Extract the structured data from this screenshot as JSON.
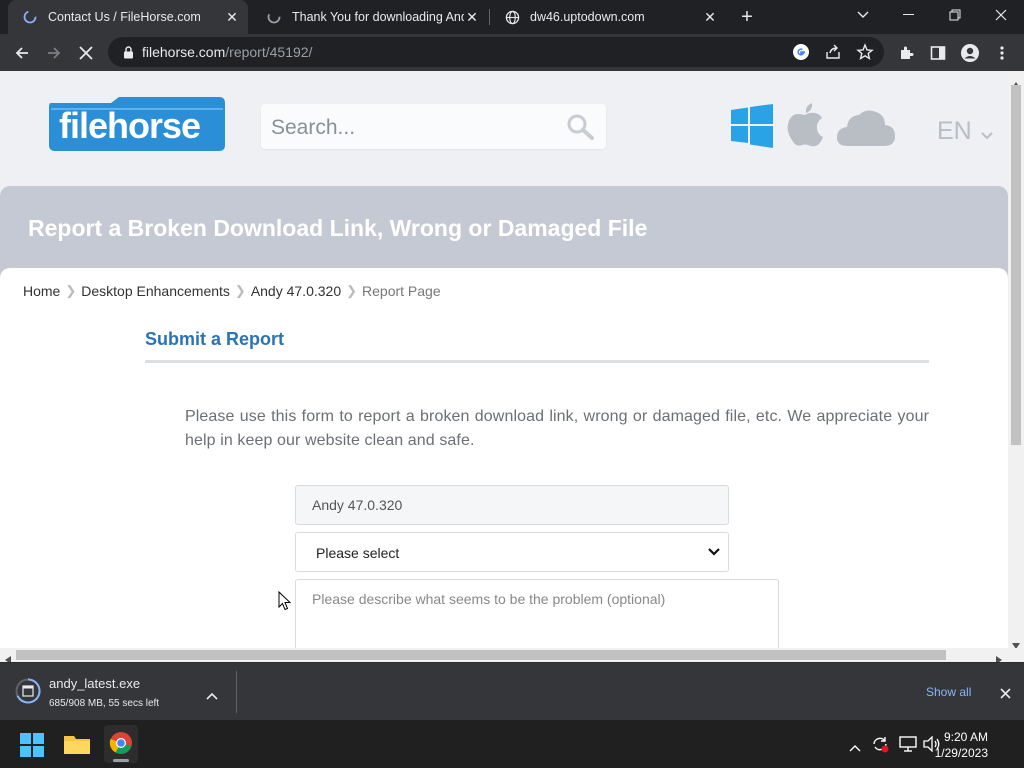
{
  "browser": {
    "tabs": [
      {
        "title": "Contact Us / FileHorse.com",
        "active": true
      },
      {
        "title": "Thank You for downloading Andy",
        "active": false
      },
      {
        "title": "dw46.uptodown.com",
        "active": false
      }
    ],
    "url": {
      "host": "filehorse.com",
      "path": "/report/45192/"
    }
  },
  "site": {
    "logo_text": "filehorse",
    "search_placeholder": "Search...",
    "language": "EN",
    "platform_icons": [
      "windows-icon",
      "apple-icon",
      "cloud-icon"
    ]
  },
  "banner": {
    "title": "Report a Broken Download Link, Wrong or Damaged File"
  },
  "breadcrumb": [
    "Home",
    "Desktop Enhancements",
    "Andy 47.0.320",
    "Report Page"
  ],
  "form": {
    "heading": "Submit a Report",
    "intro": "Please use this form to report a broken download link, wrong or damaged file, etc. We appreciate your help in keep our website clean and safe.",
    "product_value": "Andy 47.0.320",
    "select_value": "Please select",
    "description_placeholder": "Please describe what seems to be the problem (optional)"
  },
  "download": {
    "filename": "andy_latest.exe",
    "status": "685/908 MB, 55 secs left",
    "show_all": "Show all"
  },
  "taskbar": {
    "time": "9:20 AM",
    "date": "1/29/2023"
  },
  "colors": {
    "brand_blue": "#2a8fd6",
    "heading_blue": "#2a73b6",
    "banner_gray": "#c5c9d3",
    "page_bg": "#eef0f4"
  }
}
